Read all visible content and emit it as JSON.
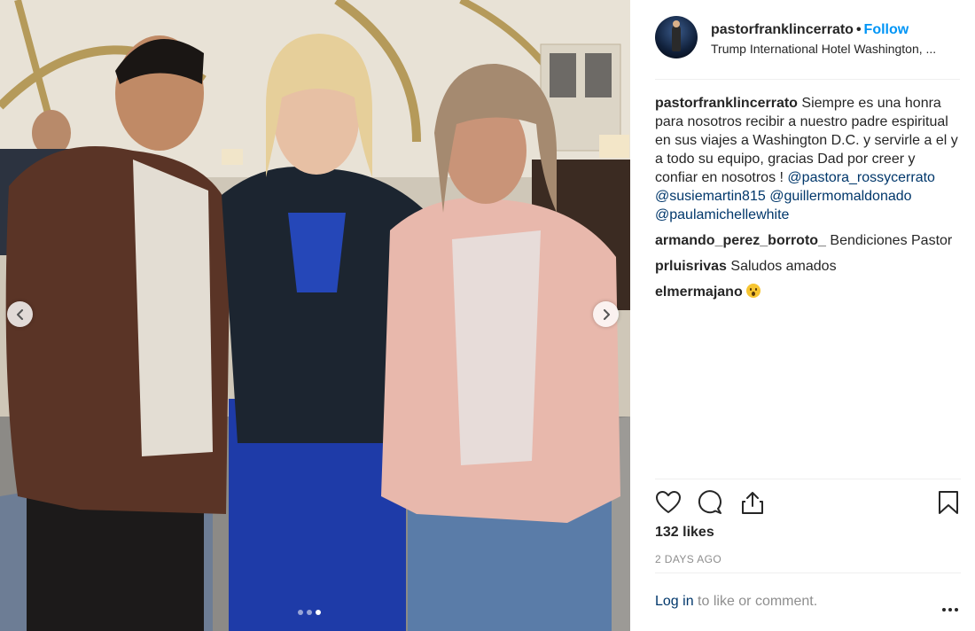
{
  "post": {
    "username": "pastorfranklincerrato",
    "bullet": "•",
    "follow_label": "Follow",
    "location": "Trump International Hotel Washington, ...",
    "carousel": {
      "total": 3,
      "active": 3
    }
  },
  "caption": {
    "username": "pastorfranklincerrato",
    "text": "Siempre es una honra para nosotros recibir a nuestro padre espiritual en sus viajes a Washington D.C. y servirle a el y a todo su equipo, gracias Dad por creer y confiar en nosotros !",
    "mentions": [
      "@pastora_rossycerrato",
      "@susiemartin815",
      "@guillermomaldonado",
      "@paulamichellewhite"
    ]
  },
  "comments": [
    {
      "username": "armando_perez_borroto_",
      "text": "Bendiciones Pastor"
    },
    {
      "username": "prluisrivas",
      "text": "Saludos amados"
    },
    {
      "username": "elmermajano",
      "text": "",
      "emoji": "astonished-face"
    }
  ],
  "stats": {
    "likes": "132 likes",
    "date": "2 DAYS AGO"
  },
  "footer": {
    "login_label": "Log in",
    "login_suffix": " to like or comment.",
    "more_icon": "ellipsis-icon"
  },
  "icons": {
    "like": "heart-icon",
    "comment": "comment-bubble-icon",
    "share": "share-icon",
    "save": "bookmark-icon",
    "prev": "chevron-left-icon",
    "next": "chevron-right-icon"
  },
  "colors": {
    "link": "#00376b",
    "follow": "#0095f6",
    "muted": "#8e8e8e",
    "text": "#262626"
  }
}
